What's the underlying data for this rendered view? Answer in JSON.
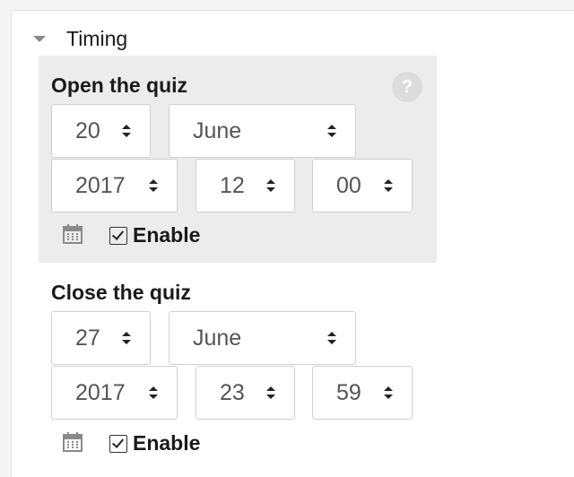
{
  "section": {
    "title": "Timing",
    "toggle_icon": "caret-down-icon"
  },
  "open_quiz": {
    "title": "Open the quiz",
    "help_icon": "help-icon",
    "help_glyph": "?",
    "day": "20",
    "month": "June",
    "year": "2017",
    "hour": "12",
    "minute": "00",
    "calendar_icon": "calendar-icon",
    "enable_label": "Enable",
    "enabled": true
  },
  "close_quiz": {
    "title": "Close the quiz",
    "day": "27",
    "month": "June",
    "year": "2017",
    "hour": "23",
    "minute": "59",
    "calendar_icon": "calendar-icon",
    "enable_label": "Enable",
    "enabled": true
  },
  "colors": {
    "highlight_bg": "#ececec",
    "panel_bg": "#ffffff",
    "text": "#1a1a1a",
    "select_text": "#555555"
  }
}
